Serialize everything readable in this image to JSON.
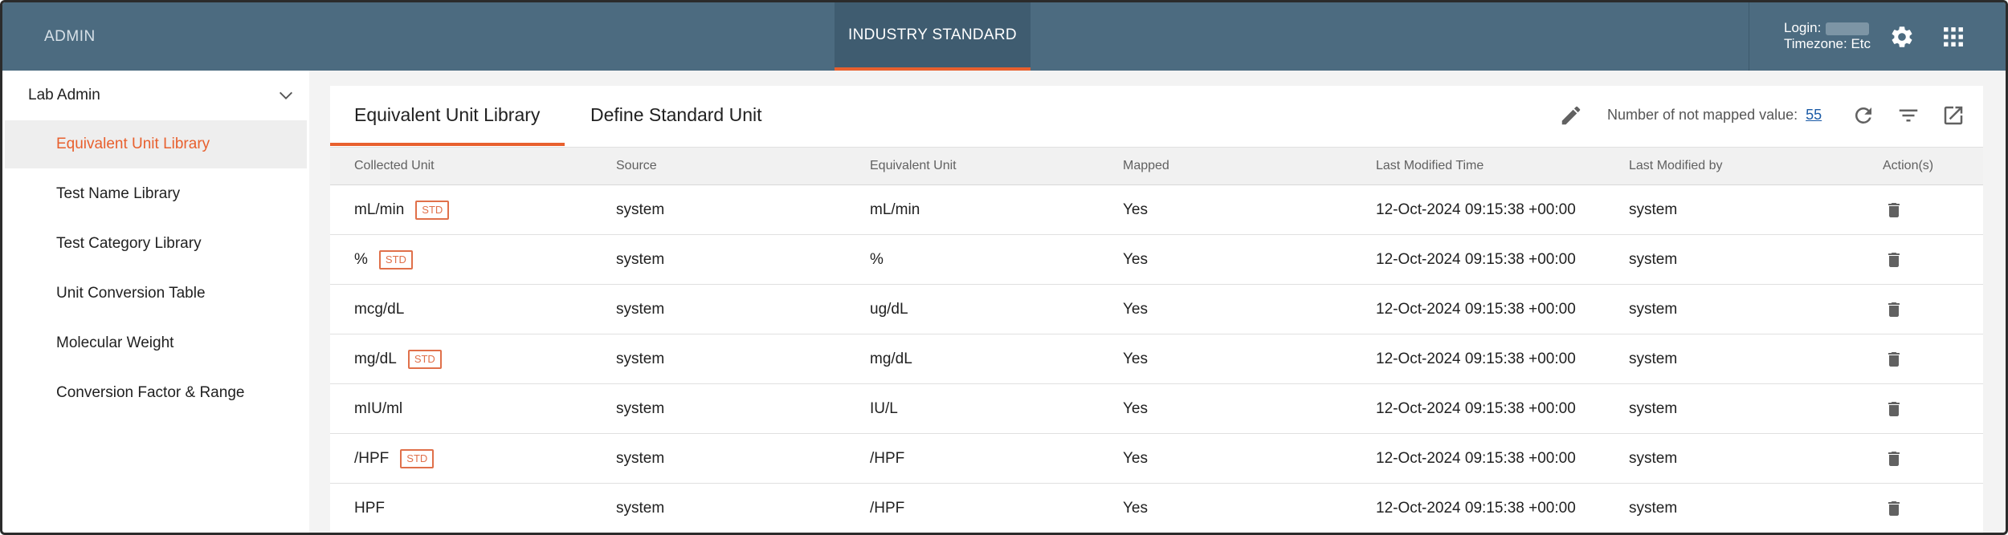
{
  "topbar": {
    "admin_label": "ADMIN",
    "active_tab_label": "INDUSTRY STANDARD",
    "login_label": "Login:",
    "timezone_label": "Timezone: Etc"
  },
  "sidebar": {
    "section_label": "Lab Admin",
    "items": [
      {
        "label": "Equivalent Unit Library",
        "active": true
      },
      {
        "label": "Test Name Library",
        "active": false
      },
      {
        "label": "Test Category Library",
        "active": false
      },
      {
        "label": "Unit Conversion Table",
        "active": false
      },
      {
        "label": "Molecular Weight",
        "active": false
      },
      {
        "label": "Conversion Factor & Range",
        "active": false
      }
    ]
  },
  "main": {
    "tabs": [
      {
        "label": "Equivalent Unit Library",
        "active": true
      },
      {
        "label": "Define Standard Unit",
        "active": false
      }
    ],
    "not_mapped_label": "Number of not mapped value:",
    "not_mapped_count": "55"
  },
  "table": {
    "headers": [
      "Collected Unit",
      "Source",
      "Equivalent Unit",
      "Mapped",
      "Last Modified Time",
      "Last Modified by",
      "Action(s)"
    ],
    "std_badge": "STD",
    "rows": [
      {
        "collected": "mL/min",
        "std": true,
        "source": "system",
        "equivalent": "mL/min",
        "mapped": "Yes",
        "time": "12-Oct-2024 09:15:38 +00:00",
        "by": "system"
      },
      {
        "collected": "%",
        "std": true,
        "source": "system",
        "equivalent": "%",
        "mapped": "Yes",
        "time": "12-Oct-2024 09:15:38 +00:00",
        "by": "system"
      },
      {
        "collected": "mcg/dL",
        "std": false,
        "source": "system",
        "equivalent": "ug/dL",
        "mapped": "Yes",
        "time": "12-Oct-2024 09:15:38 +00:00",
        "by": "system"
      },
      {
        "collected": "mg/dL",
        "std": true,
        "source": "system",
        "equivalent": "mg/dL",
        "mapped": "Yes",
        "time": "12-Oct-2024 09:15:38 +00:00",
        "by": "system"
      },
      {
        "collected": "mIU/ml",
        "std": false,
        "source": "system",
        "equivalent": "IU/L",
        "mapped": "Yes",
        "time": "12-Oct-2024 09:15:38 +00:00",
        "by": "system"
      },
      {
        "collected": "/HPF",
        "std": true,
        "source": "system",
        "equivalent": "/HPF",
        "mapped": "Yes",
        "time": "12-Oct-2024 09:15:38 +00:00",
        "by": "system"
      },
      {
        "collected": "HPF",
        "std": false,
        "source": "system",
        "equivalent": "/HPF",
        "mapped": "Yes",
        "time": "12-Oct-2024 09:15:38 +00:00",
        "by": "system"
      }
    ]
  },
  "icons": {
    "settings": "gear-icon",
    "apps": "apps-grid-icon",
    "collapse": "chevron-down-icon",
    "edit": "pencil-icon",
    "refresh": "refresh-icon",
    "filter": "filter-icon",
    "export": "open-in-new-icon",
    "delete": "trash-icon"
  },
  "colors": {
    "topbar": "#4c6b80",
    "accent": "#e8602e",
    "link": "#1a5aa6"
  }
}
